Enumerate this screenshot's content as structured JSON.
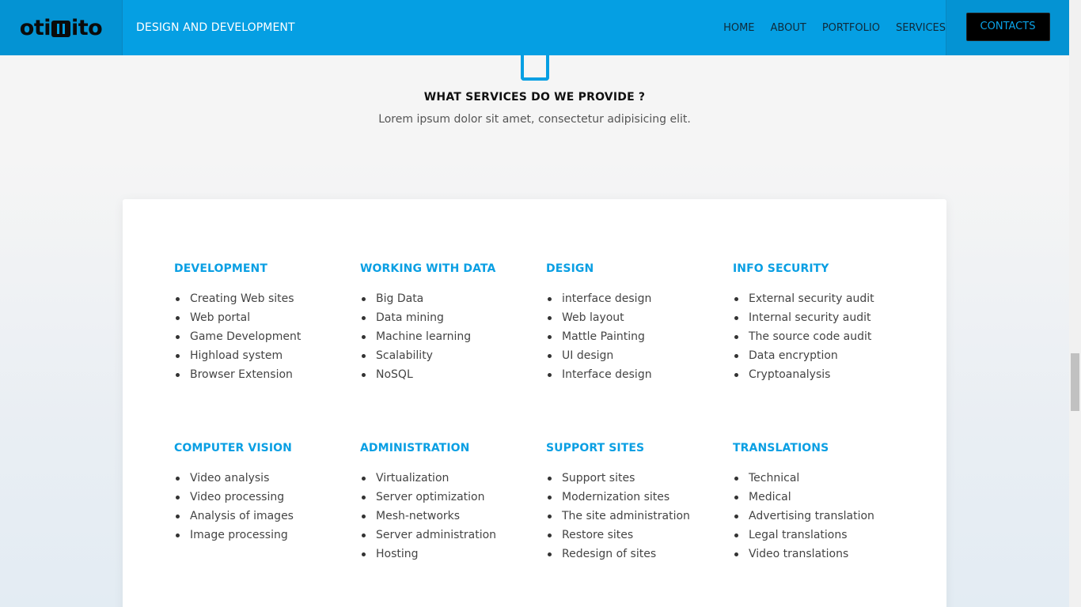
{
  "header": {
    "logo_text_left": "oti",
    "logo_text_right": "ito",
    "tagline": "DESIGN AND DEVELOPMENT",
    "nav": [
      "HOME",
      "ABOUT",
      "PORTFOLIO",
      "SERVICES"
    ],
    "contacts_label": "CONTACTS",
    "accent_color": "#059fe3"
  },
  "intro": {
    "icon": "smartphone-icon",
    "title": "WHAT SERVICES DO WE PROVIDE ?",
    "subtitle": "Lorem ipsum dolor sit amet, consectetur adipisicing elit."
  },
  "services": [
    {
      "title": "DEVELOPMENT",
      "items": [
        "Creating Web sites",
        "Web portal",
        "Game Development",
        "Highload system",
        "Browser Extension"
      ]
    },
    {
      "title": "WORKING WITH DATA",
      "items": [
        "Big Data",
        "Data mining",
        "Machine learning",
        "Scalability",
        "NoSQL"
      ]
    },
    {
      "title": "DESIGN",
      "items": [
        "interface design",
        "Web layout",
        "Mattle Painting",
        "UI design",
        "Interface design"
      ]
    },
    {
      "title": "INFO SECURITY",
      "items": [
        "External security audit",
        "Internal security audit",
        "The source code audit",
        "Data encryption",
        "Cryptoanalysis"
      ]
    },
    {
      "title": "COMPUTER VISION",
      "items": [
        "Video analysis",
        "Video processing",
        "Analysis of images",
        "Image processing"
      ]
    },
    {
      "title": "ADMINISTRATION",
      "items": [
        "Virtualization",
        "Server optimization",
        "Mesh-networks",
        "Server administration",
        "Hosting"
      ]
    },
    {
      "title": "SUPPORT SITES",
      "items": [
        "Support sites",
        "Modernization sites",
        "The site administration",
        "Restore sites",
        "Redesign of sites"
      ]
    },
    {
      "title": "TRANSLATIONS",
      "items": [
        "Technical",
        "Medical",
        "Advertising translation",
        "Legal translations",
        "Video translations"
      ]
    }
  ]
}
